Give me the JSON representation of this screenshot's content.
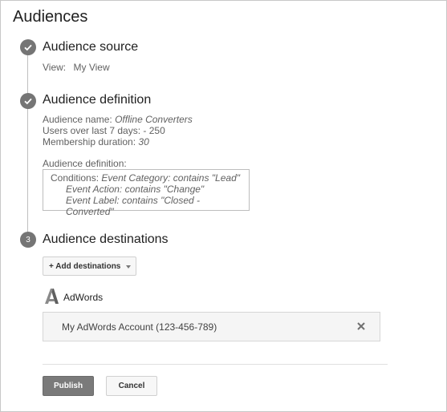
{
  "page": {
    "title": "Audiences"
  },
  "steps": {
    "source": {
      "title": "Audience source",
      "view_label": "View:",
      "view_value": "My View"
    },
    "definition": {
      "title": "Audience definition",
      "name_label": "Audience name:",
      "name_value": "Offline Converters",
      "users_label": "Users over last 7 days:",
      "users_value": "-  250",
      "duration_label": "Membership duration:",
      "duration_value": "30",
      "def_label": "Audience definition:",
      "conditions_label": "Conditions:",
      "conditions": [
        "Event Category: contains \"Lead\"",
        "Event Action: contains \"Change\"",
        "Event Label: contains \"Closed - Converted\""
      ]
    },
    "destinations": {
      "number": "3",
      "title": "Audience destinations",
      "add_button": "+ Add destinations",
      "product_name": "AdWords",
      "account": "My AdWords Account (123-456-789)"
    }
  },
  "actions": {
    "publish": "Publish",
    "cancel": "Cancel"
  },
  "icons": {
    "step_done": "check-icon",
    "remove": "close-icon",
    "product_logo": "adwords-logo-icon",
    "dropdown": "caret-down-icon"
  },
  "colors": {
    "step_circle": "#757575",
    "publish_button": "#7a7a7a"
  }
}
